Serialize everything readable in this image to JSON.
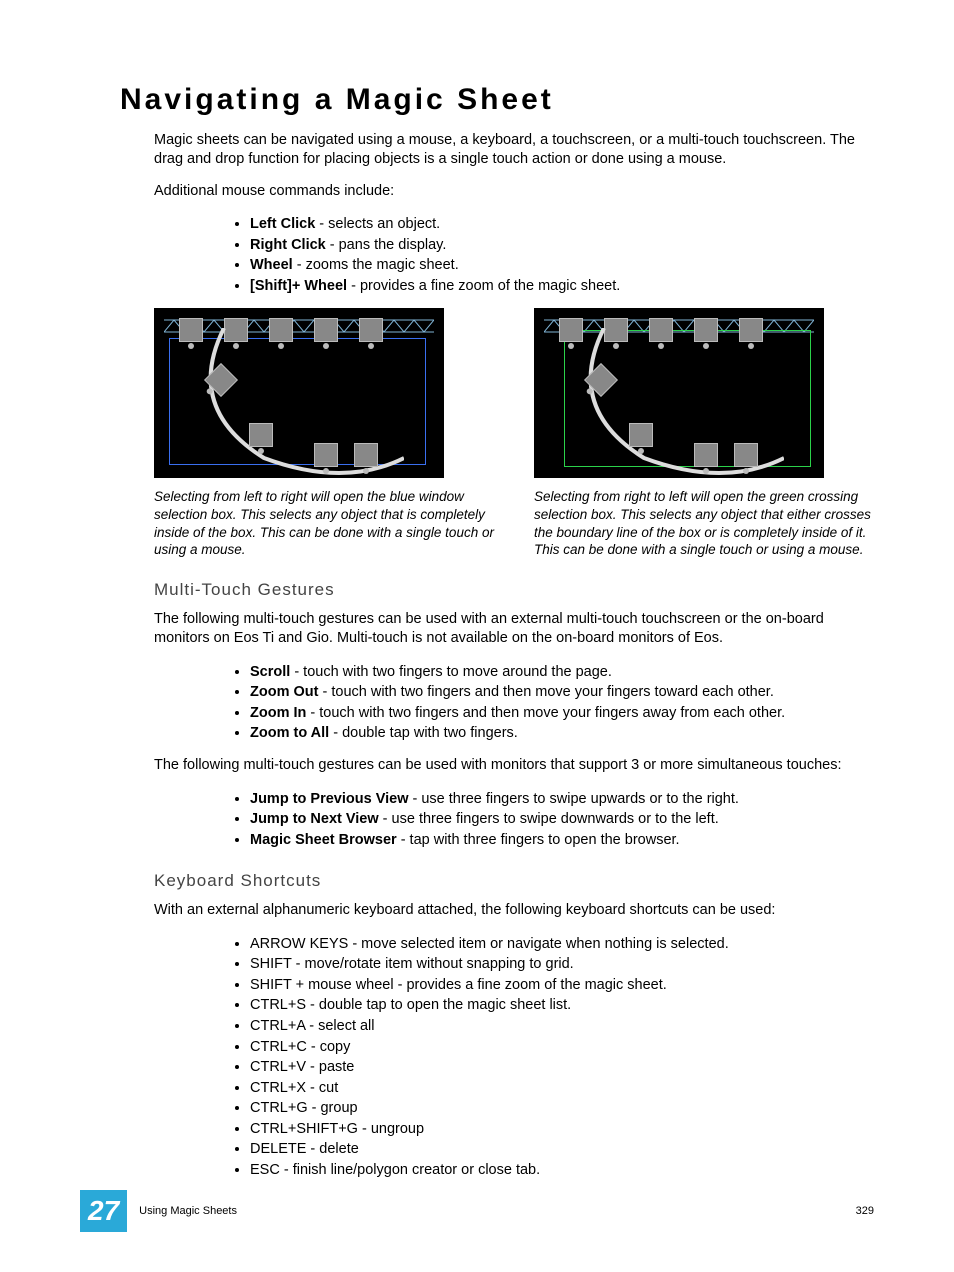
{
  "title": "Navigating a Magic Sheet",
  "intro": "Magic sheets can be navigated using a mouse, a keyboard, a touchscreen, or a multi-touch touchscreen. The drag and drop function for placing objects is a single touch action or done using a mouse.",
  "additional": "Additional mouse commands include:",
  "mouse_cmds": [
    {
      "b": "Left Click",
      "t": " - selects an object."
    },
    {
      "b": "Right Click",
      "t": " - pans the display."
    },
    {
      "b": "Wheel",
      "t": " - zooms the magic sheet."
    },
    {
      "b": "[Shift]+ Wheel",
      "t": " - provides a fine zoom of the magic sheet."
    }
  ],
  "caption_left": "Selecting from left to right will open the blue window selection box. This selects any object that is completely inside of the box. This can be done with a single touch or using a mouse.",
  "caption_right": "Selecting from right to left will open the green crossing selection box. This selects any object that either crosses the boundary line of the box or is completely inside of it. This can be done with a single touch or using a mouse.",
  "h_multi": "Multi-Touch Gestures",
  "multi_p1": "The following multi-touch gestures can be used with an external multi-touch touchscreen or the on-board monitors on Eos Ti and Gio. Multi-touch is not available on the on-board monitors of Eos.",
  "multi_list1": [
    {
      "b": "Scroll",
      "t": " - touch with two fingers to move around the page."
    },
    {
      "b": "Zoom Out",
      "t": " - touch with two fingers and then move your fingers toward each other."
    },
    {
      "b": "Zoom In",
      "t": " - touch with two fingers and then move your fingers away from each other."
    },
    {
      "b": "Zoom to All",
      "t": " - double tap with two fingers."
    }
  ],
  "multi_p2": "The following multi-touch gestures can be used with monitors that support 3 or more simultaneous touches:",
  "multi_list2": [
    {
      "b": "Jump to Previous View",
      "t": " - use three fingers to swipe upwards or to the right."
    },
    {
      "b": "Jump to Next View",
      "t": " - use three fingers to swipe downwards or to the left."
    },
    {
      "b": "Magic Sheet Browser",
      "t": " - tap with three fingers to open the browser."
    }
  ],
  "h_kbd": "Keyboard Shortcuts",
  "kbd_p": "With an external alphanumeric keyboard attached, the following keyboard shortcuts can be used:",
  "kbd_list": [
    {
      "b": "",
      "t": "ARROW KEYS - move selected item or navigate when nothing is selected."
    },
    {
      "b": "",
      "t": "SHIFT - move/rotate item without snapping to grid."
    },
    {
      "b": "",
      "t": "SHIFT + mouse wheel - provides a fine zoom of the magic sheet."
    },
    {
      "b": "",
      "t": "CTRL+S - double tap to open the magic sheet list."
    },
    {
      "b": "",
      "t": "CTRL+A - select all"
    },
    {
      "b": "",
      "t": "CTRL+C - copy"
    },
    {
      "b": "",
      "t": "CTRL+V - paste"
    },
    {
      "b": "",
      "t": "CTRL+X - cut"
    },
    {
      "b": "",
      "t": "CTRL+G - group"
    },
    {
      "b": "",
      "t": "CTRL+SHIFT+G - ungroup"
    },
    {
      "b": "",
      "t": "DELETE - delete"
    },
    {
      "b": "",
      "t": "ESC - finish line/polygon creator or close tab."
    }
  ],
  "footer": {
    "chapter": "27",
    "section": "Using Magic Sheets",
    "page": "329"
  }
}
